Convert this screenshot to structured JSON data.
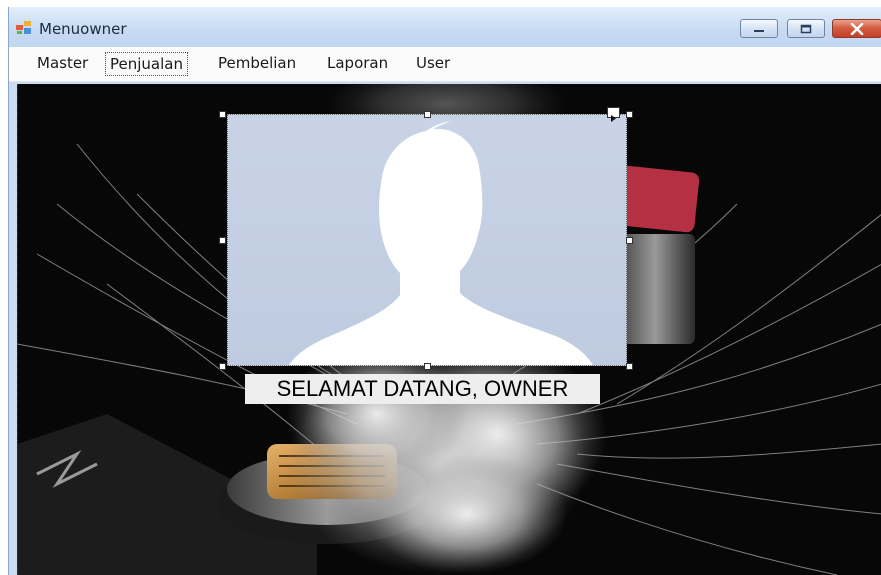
{
  "window": {
    "title": "Menuowner",
    "app_icon": "winforms-app-icon",
    "controls": {
      "minimize": "minimize-icon",
      "maximize": "maximize-icon",
      "close": "close-icon"
    }
  },
  "menu": {
    "items": [
      {
        "label": "Master"
      },
      {
        "label": "Penjualan"
      },
      {
        "label": "Pembelian"
      },
      {
        "label": "Laporan"
      },
      {
        "label": "User"
      }
    ]
  },
  "main": {
    "picture_icon": "default-avatar-silhouette",
    "welcome_label": "SELAMAT DATANG, OWNER"
  },
  "colors": {
    "title_bar": "#c6daf2",
    "menu_bar": "#fbfbfb",
    "background": "#070707",
    "picture_box": "#c8d3e6",
    "close_button": "#d35a3c"
  }
}
